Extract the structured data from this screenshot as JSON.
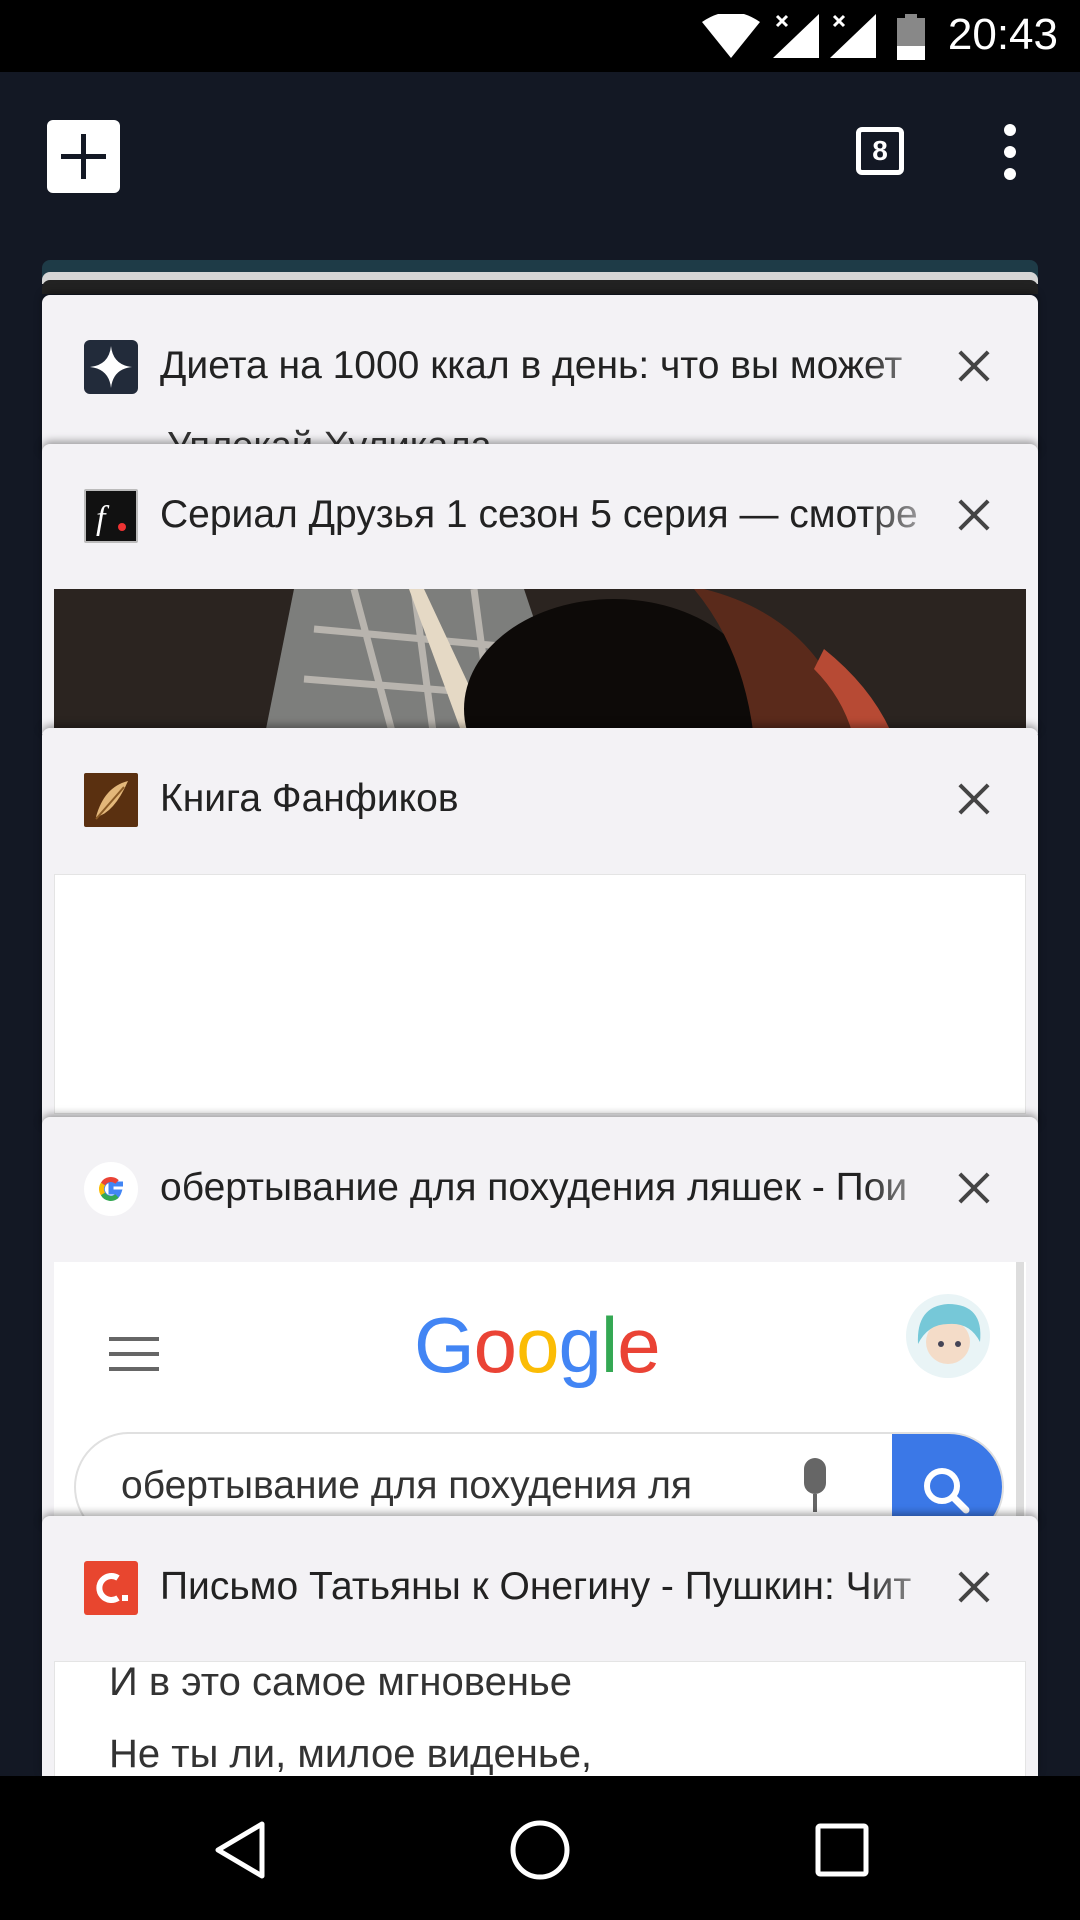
{
  "status_bar": {
    "time": "20:43"
  },
  "toolbar": {
    "tab_count": "8"
  },
  "tabs": [
    {
      "title": "Диета на 1000 ккал в день: что вы может",
      "favicon": "zen-star-icon",
      "peek_text": "Уплекай Хуликала"
    },
    {
      "title": "Сериал Друзья 1 сезон 5 серия — смотре",
      "favicon": "f-logo-icon"
    },
    {
      "title": "Книга Фанфиков",
      "favicon": "feather-icon"
    },
    {
      "title": "обертывание для похудения ляшек - Пои",
      "favicon": "google-g-icon",
      "preview": {
        "logo": "Google",
        "search_query": "обертывание для похудения ля"
      }
    },
    {
      "title": "Письмо Татьяны к Онегину - Пушкин: Чит",
      "favicon": "c-logo-icon",
      "preview": {
        "line1": "И в это самое мгновенье",
        "line2": "Не ты ли, милое виденье,"
      }
    }
  ],
  "colors": {
    "background": "#131824",
    "card": "#f3f2f5",
    "google_blue": "#4285f4",
    "google_red": "#ea4335",
    "google_yellow": "#fbbc05",
    "google_green": "#34a853"
  }
}
